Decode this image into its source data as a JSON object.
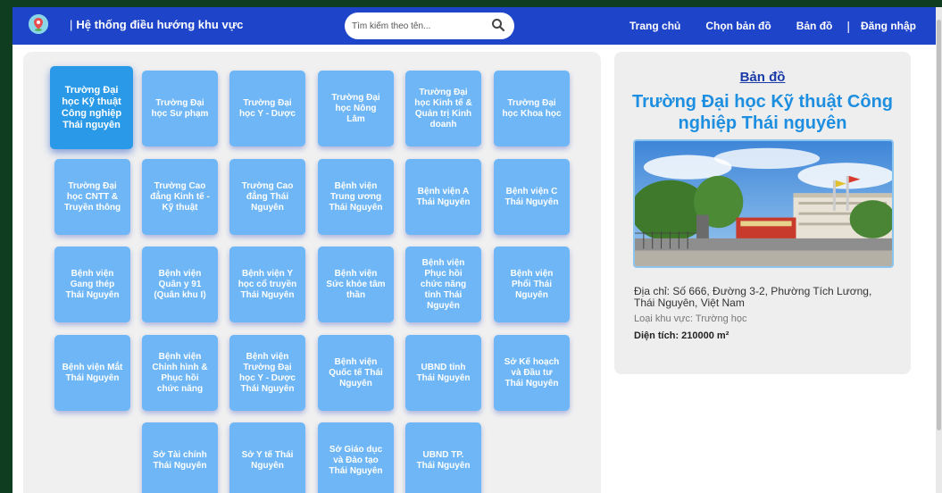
{
  "navbar": {
    "brand_sep": "|",
    "brand": "Hệ thống điều hướng khu vực",
    "search_placeholder": "Tìm kiếm theo tên...",
    "links": [
      "Trang chủ",
      "Chọn bản đồ",
      "Bản đồ",
      "Đăng nhập"
    ],
    "link_sep": "|"
  },
  "locations": [
    "Trường Đại học Kỹ thuật Công nghiệp Thái nguyên",
    "Trường Đại học Sư phạm",
    "Trường Đại học Y - Dược",
    "Trường Đại học Nông Lâm",
    "Trường Đại học Kinh tế & Quản trị Kinh doanh",
    "Trường Đại học Khoa học",
    "Trường Đại học CNTT & Truyền thông",
    "Trường Cao đẳng Kinh tế - Kỹ thuật",
    "Trường Cao đẳng Thái Nguyên",
    "Bệnh viện Trung ương Thái Nguyên",
    "Bệnh viện A Thái Nguyên",
    "Bệnh viện C Thái Nguyên",
    "Bệnh viện Gang thép Thái Nguyên",
    "Bệnh viện Quân y 91 (Quân khu I)",
    "Bệnh viện Y học cổ truyền Thái Nguyên",
    "Bệnh viện Sức khỏe tâm thần",
    "Bệnh viện Phục hồi chức năng tỉnh Thái Nguyên",
    "Bệnh viện Phổi Thái Nguyên",
    "Bệnh viện Mắt Thái Nguyên",
    "Bệnh viện Chỉnh hình & Phục hồi chức năng",
    "Bệnh viện Trường Đại học Y - Dược Thái Nguyên",
    "Bệnh viện Quốc tế Thái Nguyên",
    "UBND tỉnh Thái Nguyên",
    "Sở Kế hoạch và Đầu tư Thái Nguyên",
    "Sở Tài chính Thái Nguyên",
    "Sở Y tế Thái Nguyên",
    "Sở Giáo dục và Đào tạo Thái Nguyên",
    "UBND TP. Thái Nguyên"
  ],
  "detail": {
    "map_link": "Bản đồ",
    "title": "Trường Đại học Kỹ thuật Công nghiệp Thái nguyên",
    "address": "Địa chỉ: Số 666, Đường 3-2, Phường Tích Lương, Thái Nguyên, Việt Nam",
    "area_type": "Loại khu vực: Trường học",
    "area_size": "Diện tích: 210000 m²"
  },
  "colors": {
    "navbar": "#1e44c9",
    "tile": "#6eb6f5",
    "tile_active": "#2a9ae8",
    "title": "#1e8fe0"
  }
}
